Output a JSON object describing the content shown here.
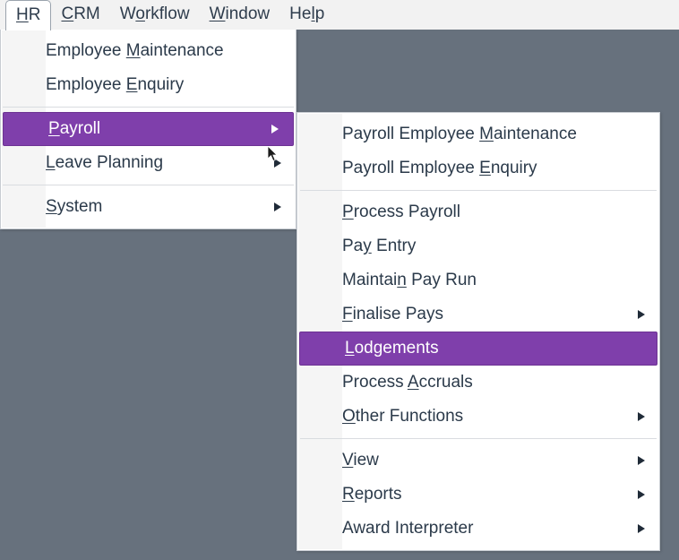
{
  "window": {
    "background_color": "#67717d",
    "menubar_background": "#f2f2f2"
  },
  "theme": {
    "highlight_color": "#7f3fab",
    "highlight_border_color": "#6d3393",
    "menu_background": "#ffffff",
    "menu_gutter": "#f5f5f5",
    "text_color": "#2b3a4a",
    "separator_color": "#d9dce0"
  },
  "menubar": {
    "items": [
      {
        "label": "HR",
        "mnemonic": "H",
        "pre": "",
        "post": "R",
        "active": true
      },
      {
        "label": "CRM",
        "mnemonic": "C",
        "pre": "",
        "post": "RM",
        "active": false
      },
      {
        "label": "Workflow",
        "mnemonic": "o",
        "pre": "W",
        "post": "rkflow",
        "active": false
      },
      {
        "label": "Window",
        "mnemonic": "W",
        "pre": "",
        "post": "indow",
        "active": false
      },
      {
        "label": "Help",
        "mnemonic": "l",
        "pre": "He",
        "post": "p",
        "active": false
      }
    ]
  },
  "menu_hr": {
    "name": "HR",
    "groups": [
      {
        "items": [
          {
            "label": "Employee Maintenance",
            "pre": "Employee ",
            "mnemonic": "M",
            "post": "aintenance",
            "submenu": false,
            "selected": false
          },
          {
            "label": "Employee Enquiry",
            "pre": "Employee ",
            "mnemonic": "E",
            "post": "nquiry",
            "submenu": false,
            "selected": false
          }
        ]
      },
      {
        "items": [
          {
            "label": "Payroll",
            "pre": "",
            "mnemonic": "P",
            "post": "ayroll",
            "submenu": true,
            "selected": true
          },
          {
            "label": "Leave Planning",
            "pre": "",
            "mnemonic": "L",
            "post": "eave Planning",
            "submenu": true,
            "selected": false
          }
        ]
      },
      {
        "items": [
          {
            "label": "System",
            "pre": "",
            "mnemonic": "S",
            "post": "ystem",
            "submenu": true,
            "selected": false
          }
        ]
      }
    ]
  },
  "menu_payroll": {
    "name": "Payroll",
    "groups": [
      {
        "items": [
          {
            "label": "Payroll Employee Maintenance",
            "pre": "Payroll Employee ",
            "mnemonic": "M",
            "post": "aintenance",
            "submenu": false,
            "selected": false
          },
          {
            "label": "Payroll Employee Enquiry",
            "pre": "Payroll Employee ",
            "mnemonic": "E",
            "post": "nquiry",
            "submenu": false,
            "selected": false
          }
        ]
      },
      {
        "items": [
          {
            "label": "Process Payroll",
            "pre": "",
            "mnemonic": "P",
            "post": "rocess Payroll",
            "submenu": false,
            "selected": false
          },
          {
            "label": "Pay Entry",
            "pre": "Pa",
            "mnemonic": "y",
            "post": " Entry",
            "submenu": false,
            "selected": false
          },
          {
            "label": "Maintain Pay Run",
            "pre": "Maintai",
            "mnemonic": "n",
            "post": " Pay Run",
            "submenu": false,
            "selected": false
          },
          {
            "label": "Finalise Pays",
            "pre": "",
            "mnemonic": "F",
            "post": "inalise Pays",
            "submenu": true,
            "selected": false
          },
          {
            "label": "Lodgements",
            "pre": "",
            "mnemonic": "L",
            "post": "odgements",
            "submenu": false,
            "selected": true
          },
          {
            "label": "Process Accruals",
            "pre": "Process ",
            "mnemonic": "A",
            "post": "ccruals",
            "submenu": false,
            "selected": false
          },
          {
            "label": "Other Functions",
            "pre": "",
            "mnemonic": "O",
            "post": "ther Functions",
            "submenu": true,
            "selected": false
          }
        ]
      },
      {
        "items": [
          {
            "label": "View",
            "pre": "",
            "mnemonic": "V",
            "post": "iew",
            "submenu": true,
            "selected": false
          },
          {
            "label": "Reports",
            "pre": "",
            "mnemonic": "R",
            "post": "eports",
            "submenu": true,
            "selected": false
          },
          {
            "label": "Award Interpreter",
            "pre": "Award Interpreter",
            "mnemonic": "",
            "post": "",
            "submenu": true,
            "selected": false
          }
        ]
      }
    ]
  }
}
